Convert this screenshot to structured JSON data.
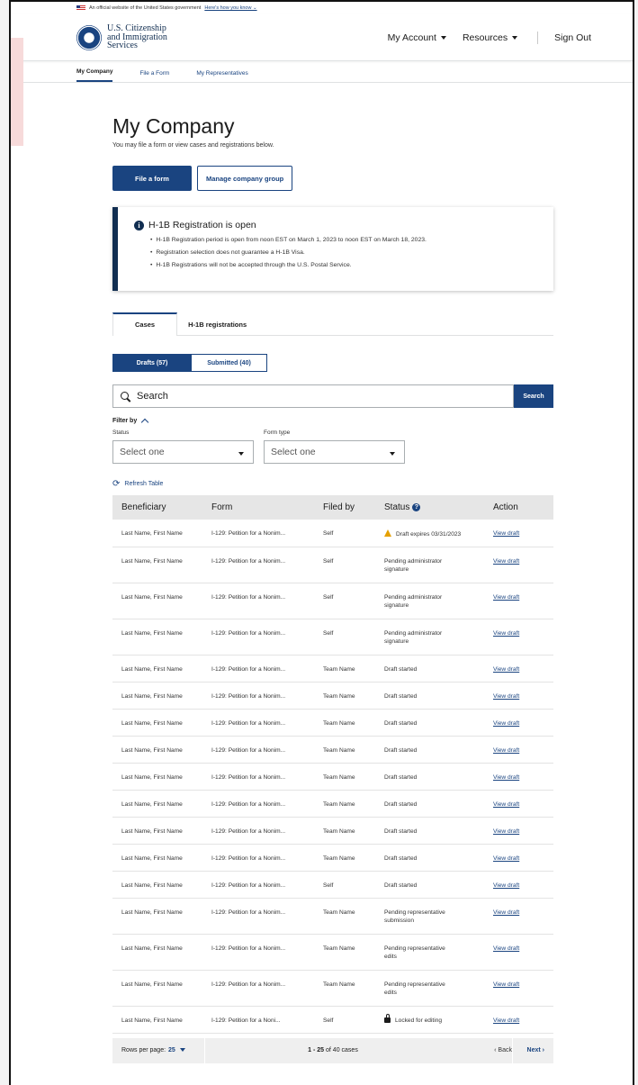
{
  "gov_banner": {
    "text": "An official website of the United States government",
    "link": "Here's how you know ⌄"
  },
  "agency": {
    "line1": "U.S. Citizenship",
    "line2": "and Immigration",
    "line3": "Services"
  },
  "header_menu": {
    "account": "My Account",
    "resources": "Resources",
    "signout": "Sign Out"
  },
  "subnav": [
    {
      "label": "My Company",
      "active": true
    },
    {
      "label": "File a Form"
    },
    {
      "label": "My Representatives"
    }
  ],
  "page": {
    "title": "My Company",
    "subtitle": "You may file a form or view cases and registrations below."
  },
  "buttons": {
    "file_form": "File a form",
    "manage_group": "Manage company group"
  },
  "alert": {
    "title": "H-1B Registration is open",
    "items": [
      "H-1B Registration period is open from noon EST on March 1, 2023 to noon EST on March 18, 2023.",
      "Registration selection does not guarantee a H-1B Visa.",
      "H-1B Registrations will not be accepted through the U.S. Postal Service."
    ]
  },
  "tabs": {
    "cases": "Cases",
    "h1b": "H-1B registrations"
  },
  "segments": {
    "drafts": "Drafts (57)",
    "submitted": "Submitted (40)"
  },
  "search": {
    "placeholder": "Search",
    "button": "Search"
  },
  "filters": {
    "title": "Filter by",
    "status_label": "Status",
    "status_value": "Select one",
    "form_label": "Form type",
    "form_value": "Select one"
  },
  "refresh": "Refresh Table",
  "table": {
    "headers": [
      "Beneficiary",
      "Form",
      "Filed by",
      "Status",
      "Action"
    ],
    "rows": [
      {
        "b": "Last Name, First Name",
        "f": "I-129: Petition for a Nonim...",
        "by": "Self",
        "s1": "Draft expires 03/31/2023",
        "s2": "",
        "icon": "warning",
        "a": "View draft",
        "tall": false
      },
      {
        "b": "Last Name, First Name",
        "f": "I-129: Petition for a Nonim...",
        "by": "Self",
        "s1": "Pending administrator",
        "s2": "signature",
        "icon": "",
        "a": "View draft",
        "tall": true
      },
      {
        "b": "Last Name, First Name",
        "f": "I-129: Petition for a Nonim...",
        "by": "Self",
        "s1": "Pending administrator",
        "s2": "signature",
        "icon": "",
        "a": "View draft",
        "tall": true
      },
      {
        "b": "Last Name, First Name",
        "f": "I-129: Petition for a Nonim...",
        "by": "Self",
        "s1": "Pending administrator",
        "s2": "signature",
        "icon": "",
        "a": "View draft",
        "tall": true
      },
      {
        "b": "Last Name, First Name",
        "f": "I-129: Petition for a Nonim...",
        "by": "Team Name",
        "s1": "Draft started",
        "s2": "",
        "icon": "",
        "a": "View draft",
        "tall": false
      },
      {
        "b": "Last Name, First Name",
        "f": "I-129: Petition for a Nonim...",
        "by": "Team Name",
        "s1": "Draft started",
        "s2": "",
        "icon": "",
        "a": "View draft",
        "tall": false
      },
      {
        "b": "Last Name, First Name",
        "f": "I-129: Petition for a Nonim...",
        "by": "Team Name",
        "s1": "Draft started",
        "s2": "",
        "icon": "",
        "a": "View draft",
        "tall": false
      },
      {
        "b": "Last Name, First Name",
        "f": "I-129: Petition for a Nonim...",
        "by": "Team Name",
        "s1": "Draft started",
        "s2": "",
        "icon": "",
        "a": "View draft",
        "tall": false
      },
      {
        "b": "Last Name, First Name",
        "f": "I-129: Petition for a Nonim...",
        "by": "Team Name",
        "s1": "Draft started",
        "s2": "",
        "icon": "",
        "a": "View draft",
        "tall": false
      },
      {
        "b": "Last Name, First Name",
        "f": "I-129: Petition for a Nonim...",
        "by": "Team Name",
        "s1": "Draft started",
        "s2": "",
        "icon": "",
        "a": "View draft",
        "tall": false
      },
      {
        "b": "Last Name, First Name",
        "f": "I-129: Petition for a Nonim...",
        "by": "Team Name",
        "s1": "Draft started",
        "s2": "",
        "icon": "",
        "a": "View draft",
        "tall": false
      },
      {
        "b": "Last Name, First Name",
        "f": "I-129: Petition for a Nonim...",
        "by": "Team Name",
        "s1": "Draft started",
        "s2": "",
        "icon": "",
        "a": "View draft",
        "tall": false
      },
      {
        "b": "Last Name, First Name",
        "f": "I-129: Petition for a Nonim...",
        "by": "Self",
        "s1": "Draft started",
        "s2": "",
        "icon": "",
        "a": "View draft",
        "tall": false
      },
      {
        "b": "Last Name, First Name",
        "f": "I-129: Petition for a Nonim...",
        "by": "Team Name",
        "s1": "Pending representative",
        "s2": "submission",
        "icon": "",
        "a": "View draft",
        "tall": true
      },
      {
        "b": "Last Name, First Name",
        "f": "I-129: Petition for a Nonim...",
        "by": "Team Name",
        "s1": "Pending representative",
        "s2": "edits",
        "icon": "",
        "a": "View draft",
        "tall": true
      },
      {
        "b": "Last Name, First Name",
        "f": "I-129: Petition for a Nonim...",
        "by": "Team Name",
        "s1": "Pending representative",
        "s2": "edits",
        "icon": "",
        "a": "View draft",
        "tall": true
      },
      {
        "b": "Last Name, First Name",
        "f": "I-129: Petition for a Noni...",
        "by": "Self",
        "s1": "Locked for editing",
        "s2": "",
        "icon": "lock",
        "a": "View draft",
        "tall": false
      }
    ]
  },
  "pager": {
    "rows_label": "Rows per page:",
    "rows_value": "25",
    "range": "1 - 25",
    "total": " of 40 cases",
    "back": "‹ Back",
    "next": "Next ›"
  },
  "colors": {
    "primary": "#1a4480",
    "alert_border": "#112e51",
    "warning": "#e5a000"
  }
}
